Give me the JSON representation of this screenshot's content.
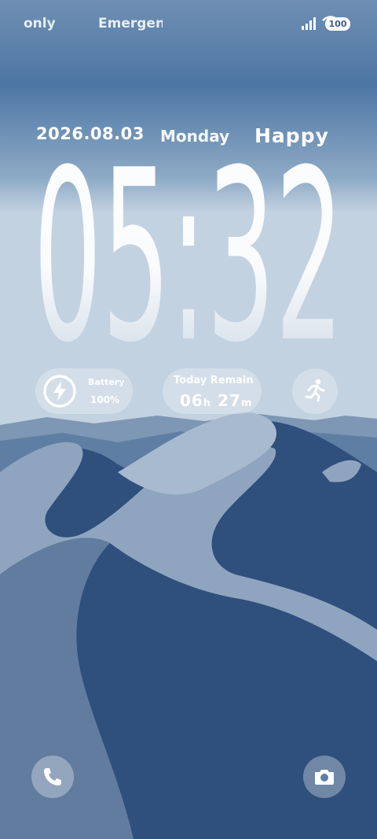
{
  "status_bar": {
    "carrier_1": "only",
    "carrier_2": "Emergency",
    "battery_level": "100",
    "icons": [
      "signal-icon",
      "wifi-icon",
      "battery-icon"
    ]
  },
  "lock_screen": {
    "date": "2026.08.03",
    "weekday": "Monday",
    "greeting": "Happy",
    "time": "05:32"
  },
  "widgets": {
    "battery": {
      "label": "Battery",
      "value": "100%",
      "icon": "bolt-icon"
    },
    "today_remain": {
      "label": "Today Remain",
      "hours": "06",
      "hours_unit": "h",
      "minutes": "27",
      "minutes_unit": "m"
    },
    "activity": {
      "icon": "running-icon"
    }
  },
  "shortcuts": {
    "left": "phone-icon",
    "right": "camera-icon"
  },
  "colors": {
    "sky_top": "#6e8fb1",
    "dune_light": "#8da3bd",
    "dune_dark": "#2e4b78"
  }
}
